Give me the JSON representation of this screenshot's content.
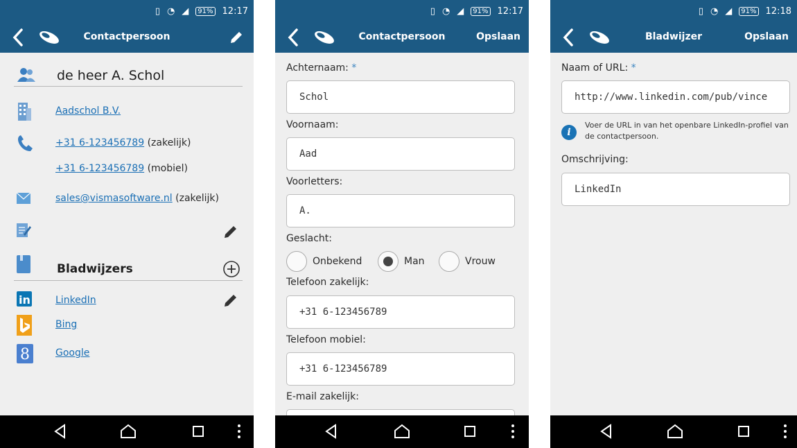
{
  "screen1": {
    "status": {
      "time": "12:17",
      "battery": "91%"
    },
    "appbar": {
      "title": "Contactpersoon"
    },
    "contact": {
      "name": "de heer A. Schol",
      "company": "Aadschol B.V.",
      "phone_business": "+31 6-123456789",
      "phone_business_type": " (zakelijk)",
      "phone_mobile": "+31 6-123456789",
      "phone_mobile_type": " (mobiel)",
      "email": "sales@vismasoftware.nl",
      "email_type": " (zakelijk)"
    },
    "bookmarks": {
      "heading": "Bladwijzers",
      "items": [
        {
          "label": "LinkedIn",
          "icon": "linkedin-icon"
        },
        {
          "label": "Bing",
          "icon": "bing-icon"
        },
        {
          "label": "Google",
          "icon": "google-icon"
        }
      ]
    }
  },
  "screen2": {
    "status": {
      "time": "12:17",
      "battery": "91%"
    },
    "appbar": {
      "title": "Contactpersoon",
      "action": "Opslaan"
    },
    "form": {
      "lastname_label": "Achternaam:",
      "required_mark": "*",
      "lastname_value": "Schol",
      "firstname_label": "Voornaam:",
      "firstname_value": "Aad",
      "initials_label": "Voorletters:",
      "initials_value": "A.",
      "gender_label": "Geslacht:",
      "gender_options": [
        "Onbekend",
        "Man",
        "Vrouw"
      ],
      "gender_selected": "Man",
      "phone_business_label": "Telefoon zakelijk:",
      "phone_business_value": "+31 6-123456789",
      "phone_mobile_label": "Telefoon mobiel:",
      "phone_mobile_value": "+31 6-123456789",
      "email_business_label": "E-mail zakelijk:"
    }
  },
  "screen3": {
    "status": {
      "time": "12:18",
      "battery": "91%"
    },
    "appbar": {
      "title": "Bladwijzer",
      "action": "Opslaan"
    },
    "form": {
      "url_label": "Naam of URL:",
      "required_mark": "*",
      "url_value": "http://www.linkedin.com/pub/vince",
      "hint": "Voer de URL in van het openbare LinkedIn-profiel van de contactpersoon.",
      "description_label": "Omschrijving:",
      "description_value": "LinkedIn"
    }
  },
  "colors": {
    "appbar": "#1c5a84",
    "link": "#1a6fb5",
    "background": "#efefef",
    "navbar": "#000000"
  }
}
